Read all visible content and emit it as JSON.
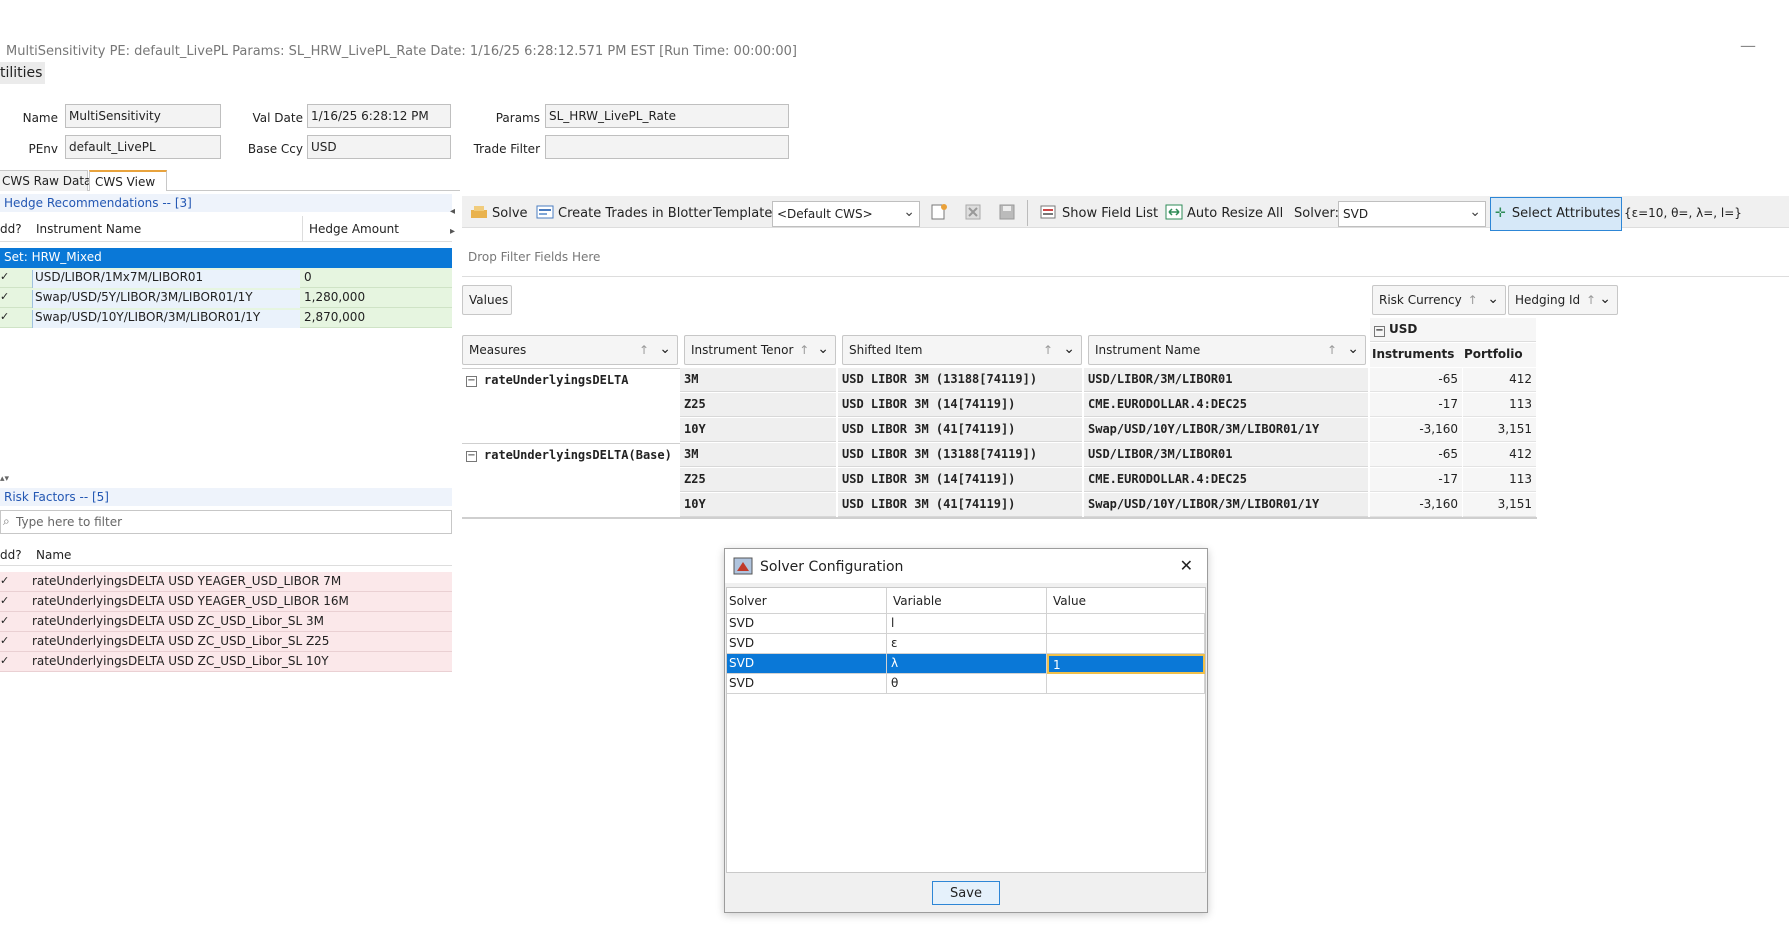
{
  "window": {
    "title": "MultiSensitivity PE: default_LivePL Params: SL_HRW_LivePL_Rate Date: 1/16/25 6:28:12.571 PM EST [Run Time: 00:00:00]",
    "minimize": "—"
  },
  "menu": {
    "item": "tilities"
  },
  "form": {
    "name_label": "Name",
    "name_value": "MultiSensitivity",
    "penv_label": "PEnv",
    "penv_value": "default_LivePL",
    "valdate_label": "Val Date",
    "valdate_value": "1/16/25 6:28:12 PM",
    "baseccy_label": "Base Ccy",
    "baseccy_value": "USD",
    "params_label": "Params",
    "params_value": "SL_HRW_LivePL_Rate",
    "tradefilter_label": "Trade Filter",
    "tradefilter_value": ""
  },
  "tabs": [
    "CWS Raw Data",
    "CWS View"
  ],
  "hedge": {
    "title": "Hedge Recommendations -- [3]",
    "col_add": "dd?",
    "col_name": "Instrument Name",
    "col_amount": "Hedge Amount",
    "set_row": "Set: HRW_Mixed",
    "rows": [
      {
        "name": "USD/LIBOR/1Mx7M/LIBOR01",
        "amount": "0"
      },
      {
        "name": "Swap/USD/5Y/LIBOR/3M/LIBOR01/1Y",
        "amount": "1,280,000"
      },
      {
        "name": "Swap/USD/10Y/LIBOR/3M/LIBOR01/1Y",
        "amount": "2,870,000"
      }
    ]
  },
  "risk": {
    "title": "Risk Factors -- [5]",
    "filter_placeholder": "Type here to filter",
    "col_add": "dd?",
    "col_name": "Name",
    "rows": [
      "rateUnderlyingsDELTA USD YEAGER_USD_LIBOR 7M",
      "rateUnderlyingsDELTA USD YEAGER_USD_LIBOR 16M",
      "rateUnderlyingsDELTA USD ZC_USD_Libor_SL 3M",
      "rateUnderlyingsDELTA USD ZC_USD_Libor_SL Z25",
      "rateUnderlyingsDELTA USD ZC_USD_Libor_SL 10Y"
    ]
  },
  "toolbar": {
    "solve": "Solve",
    "create_trades": "Create Trades in Blotter",
    "template_label": "Template:",
    "template_value": "<Default CWS>",
    "show_field_list": "Show Field List",
    "auto_resize": "Auto Resize All",
    "solver_label": "Solver:",
    "solver_value": "SVD",
    "select_attributes": "Select Attributes",
    "attr_summary": "{ε=10, θ=, λ=, l=}"
  },
  "pivot": {
    "drop_filter": "Drop Filter Fields Here",
    "values": "Values",
    "risk_currency": "Risk Currency",
    "hedging_id": "Hedging Id",
    "measures": "Measures",
    "instrument_tenor": "Instrument Tenor",
    "shifted_item": "Shifted Item",
    "instrument_name": "Instrument Name",
    "currency_group": "USD",
    "col_instruments": "Instruments",
    "col_portfolio": "Portfolio",
    "groups": [
      {
        "measure": "rateUnderlyingsDELTA",
        "rows": [
          {
            "tenor": "3M",
            "shifted": "USD LIBOR 3M (13188[74119])",
            "name": "USD/LIBOR/3M/LIBOR01",
            "instruments": "-65",
            "portfolio": "412"
          },
          {
            "tenor": "Z25",
            "shifted": "USD LIBOR 3M (14[74119])",
            "name": "CME.EURODOLLAR.4:DEC25",
            "instruments": "-17",
            "portfolio": "113"
          },
          {
            "tenor": "10Y",
            "shifted": "USD LIBOR 3M (41[74119])",
            "name": "Swap/USD/10Y/LIBOR/3M/LIBOR01/1Y",
            "instruments": "-3,160",
            "portfolio": "3,151"
          }
        ]
      },
      {
        "measure": "rateUnderlyingsDELTA(Base)",
        "rows": [
          {
            "tenor": "3M",
            "shifted": "USD LIBOR 3M (13188[74119])",
            "name": "USD/LIBOR/3M/LIBOR01",
            "instruments": "-65",
            "portfolio": "412"
          },
          {
            "tenor": "Z25",
            "shifted": "USD LIBOR 3M (14[74119])",
            "name": "CME.EURODOLLAR.4:DEC25",
            "instruments": "-17",
            "portfolio": "113"
          },
          {
            "tenor": "10Y",
            "shifted": "USD LIBOR 3M (41[74119])",
            "name": "Swap/USD/10Y/LIBOR/3M/LIBOR01/1Y",
            "instruments": "-3,160",
            "portfolio": "3,151"
          }
        ]
      }
    ]
  },
  "dialog": {
    "title": "Solver Configuration",
    "close": "✕",
    "col_solver": "Solver",
    "col_variable": "Variable",
    "col_value": "Value",
    "rows": [
      {
        "solver": "SVD",
        "variable": "l",
        "value": ""
      },
      {
        "solver": "SVD",
        "variable": "ε",
        "value": ""
      },
      {
        "solver": "SVD",
        "variable": "λ",
        "value": "1"
      },
      {
        "solver": "SVD",
        "variable": "θ",
        "value": ""
      }
    ],
    "save": "Save"
  },
  "colors": {
    "selection": "#0a78d7",
    "set_row": "#0a78d7",
    "hedge_row": "#e6f5e0",
    "risk_row": "#fbe8ea",
    "accent_tab": "#e8a33d"
  }
}
